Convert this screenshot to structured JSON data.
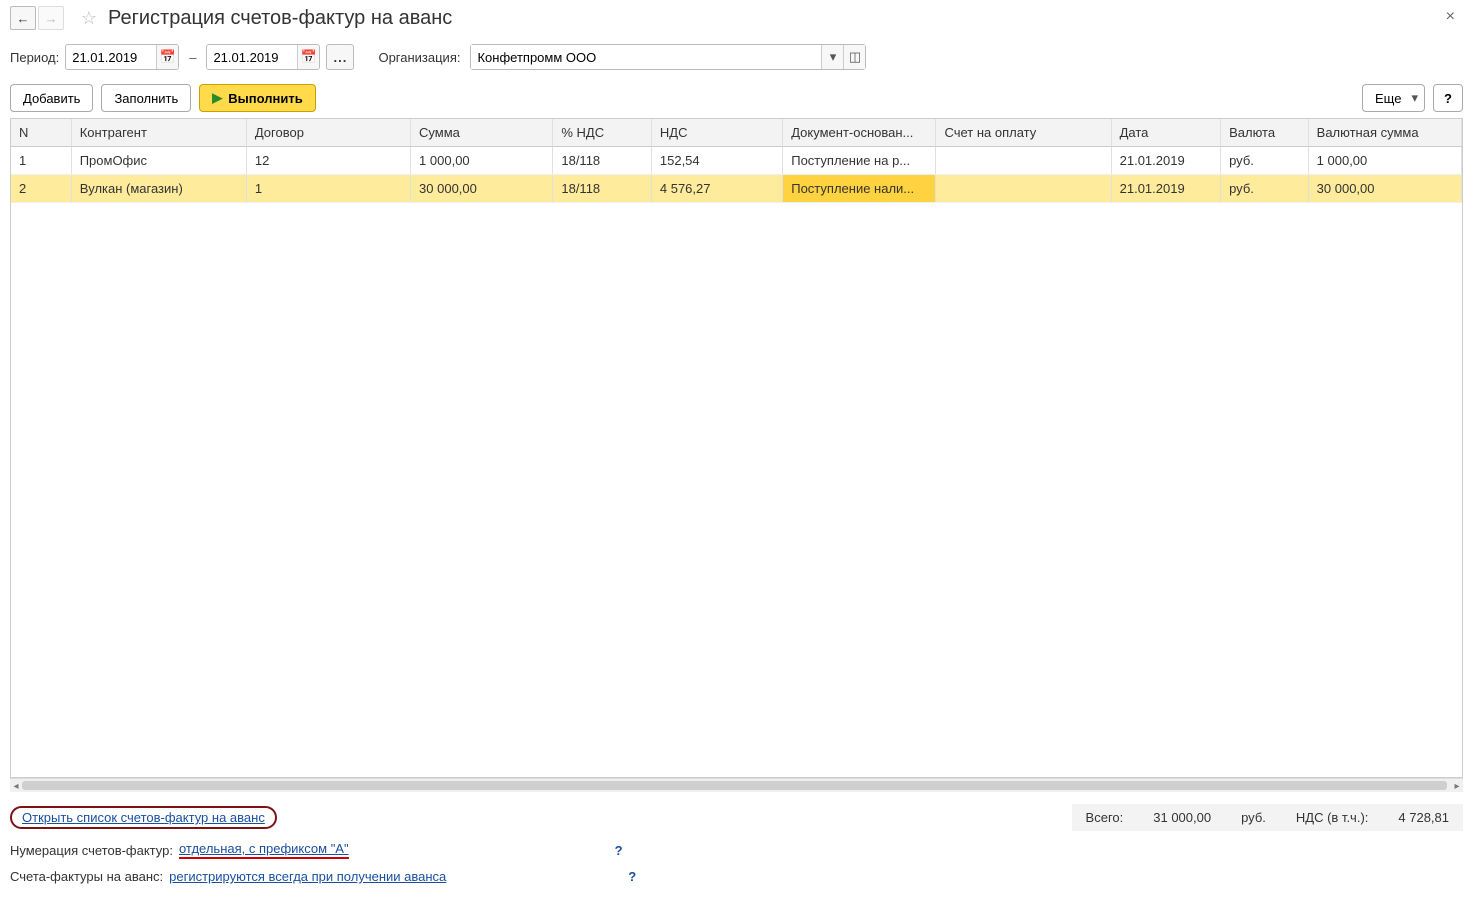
{
  "title": "Регистрация счетов-фактур на аванс",
  "period_label": "Период:",
  "date_from": "21.01.2019",
  "date_to": "21.01.2019",
  "org_label": "Организация:",
  "org_value": "Конфетпромм ООО",
  "toolbar": {
    "add": "Добавить",
    "fill": "Заполнить",
    "run": "Выполнить",
    "more": "Еще",
    "help": "?"
  },
  "columns": {
    "n": "N",
    "counterparty": "Контрагент",
    "contract": "Договор",
    "sum": "Сумма",
    "vat_pct": "% НДС",
    "vat": "НДС",
    "basis": "Документ-основан...",
    "invoice": "Счет на оплату",
    "date": "Дата",
    "currency": "Валюта",
    "csum": "Валютная сумма"
  },
  "rows": [
    {
      "n": "1",
      "counterparty": "ПромОфис",
      "contract": "12",
      "sum": "1 000,00",
      "vat_pct": "18/118",
      "vat": "152,54",
      "basis": "Поступление на р...",
      "invoice": "",
      "date": "21.01.2019",
      "currency": "руб.",
      "csum": "1 000,00"
    },
    {
      "n": "2",
      "counterparty": "Вулкан (магазин)",
      "contract": "1",
      "sum": "30 000,00",
      "vat_pct": "18/118",
      "vat": "4 576,27",
      "basis": "Поступление нали...",
      "invoice": "",
      "date": "21.01.2019",
      "currency": "руб.",
      "csum": "30 000,00"
    }
  ],
  "open_link": "Открыть список счетов-фактур на аванс",
  "totals": {
    "label_total": "Всего:",
    "total": "31 000,00",
    "cur": "руб.",
    "label_vat": "НДС (в т.ч.):",
    "vat": "4 728,81"
  },
  "numbering": {
    "label": "Нумерация счетов-фактур:",
    "value": "отдельная, с префиксом \"А\""
  },
  "advance": {
    "label": "Счета-фактуры на аванс:",
    "value": "регистрируются всегда при получении аванса"
  },
  "q": "?"
}
